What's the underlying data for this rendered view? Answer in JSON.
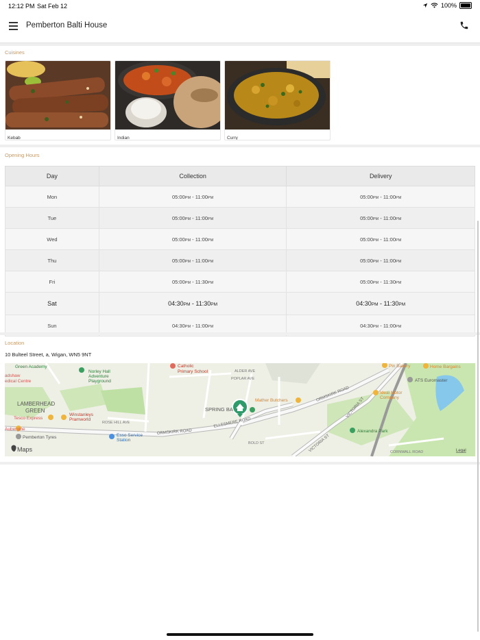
{
  "status_bar": {
    "time": "12:12 PM",
    "date": "Sat Feb 12",
    "battery": "100%"
  },
  "header": {
    "title": "Pemberton Balti House",
    "menu_icon": "hamburger-icon",
    "phone_icon": "phone-icon"
  },
  "cuisines": {
    "label": "Cuisines",
    "items": [
      {
        "name": "Kebab"
      },
      {
        "name": "Indian"
      },
      {
        "name": "Curry"
      }
    ]
  },
  "opening_hours": {
    "label": "Opening Hours",
    "columns": [
      "Day",
      "Collection",
      "Delivery"
    ],
    "rows": [
      {
        "day": "Mon",
        "c_start": "05:00",
        "c_start_ampm": "PM",
        "c_end": "11:00",
        "c_end_ampm": "PM",
        "d_start": "05:00",
        "d_start_ampm": "PM",
        "d_end": "11:00",
        "d_end_ampm": "PM"
      },
      {
        "day": "Tue",
        "c_start": "05:00",
        "c_start_ampm": "PM",
        "c_end": "11:00",
        "c_end_ampm": "PM",
        "d_start": "05:00",
        "d_start_ampm": "PM",
        "d_end": "11:00",
        "d_end_ampm": "PM"
      },
      {
        "day": "Wed",
        "c_start": "05:00",
        "c_start_ampm": "PM",
        "c_end": "11:00",
        "c_end_ampm": "PM",
        "d_start": "05:00",
        "d_start_ampm": "PM",
        "d_end": "11:00",
        "d_end_ampm": "PM"
      },
      {
        "day": "Thu",
        "c_start": "05:00",
        "c_start_ampm": "PM",
        "c_end": "11:00",
        "c_end_ampm": "PM",
        "d_start": "05:00",
        "d_start_ampm": "PM",
        "d_end": "11:00",
        "d_end_ampm": "PM"
      },
      {
        "day": "Fri",
        "c_start": "05:00",
        "c_start_ampm": "PM",
        "c_end": "11:30",
        "c_end_ampm": "PM",
        "d_start": "05:00",
        "d_start_ampm": "PM",
        "d_end": "11:30",
        "d_end_ampm": "PM"
      },
      {
        "day": "Sat",
        "c_start": "04:30",
        "c_start_ampm": "PM",
        "c_end": "11:30",
        "c_end_ampm": "PM",
        "d_start": "04:30",
        "d_start_ampm": "PM",
        "d_end": "11:30",
        "d_end_ampm": "PM",
        "today": true
      },
      {
        "day": "Sun",
        "c_start": "04:30",
        "c_start_ampm": "PM",
        "c_end": "11:00",
        "c_end_ampm": "PM",
        "d_start": "04:30",
        "d_start_ampm": "PM",
        "d_end": "11:00",
        "d_end_ampm": "PM"
      }
    ]
  },
  "location": {
    "label": "Location",
    "address": "10 Bulteel Street, a, Wigan, WN5 9NT",
    "map": {
      "brand": "Maps",
      "legal": "Legal",
      "labels": {
        "green_academy": "Green Academy",
        "catholic": "Catholic",
        "primary_school": "Primary School",
        "norley_hall": "Norley Hall",
        "adventure": "Adventure",
        "playground": "Playground",
        "lamberhead": "LAMBERHEAD",
        "green": "GREEN",
        "tesco": "Tesco Express",
        "winstanleys": "Winstanleys",
        "pramworld": "Pramworld",
        "aubergine": "Aubergine",
        "pemberton_tyres": "Pemberton Tyres",
        "esso": "Esso Service",
        "station": "Station",
        "spring_bank": "SPRING BA",
        "mather": "Mather Butchers",
        "ellesmere": "ELLESMERE ROAD",
        "ormskirk1": "ORMSKIRK ROAD",
        "ormskirk2": "ORMSKIRK ROAD",
        "pin_bakery": "Pin Bakery",
        "home_bargains": "Home Bargains",
        "ats": "ATS Euromaster",
        "ideal_motor": "Ideal Motor",
        "company": "Company",
        "victoria1": "VICTORIA ST",
        "victoria2": "VICTORIA ST",
        "alexandra": "Alexandra Park",
        "bold_st": "BOLD ST",
        "alder_ave": "ALDER AVE",
        "poplar_ave": "POPLAR AVE",
        "rose_hill": "ROSE HILL AVE",
        "adshaw": "adshaw",
        "edical": "edical Centre",
        "cornwall_rd": "CORNWALL ROAD"
      }
    }
  },
  "colors": {
    "accent": "#c19a6b",
    "map_pin": "#2e9b6a"
  }
}
